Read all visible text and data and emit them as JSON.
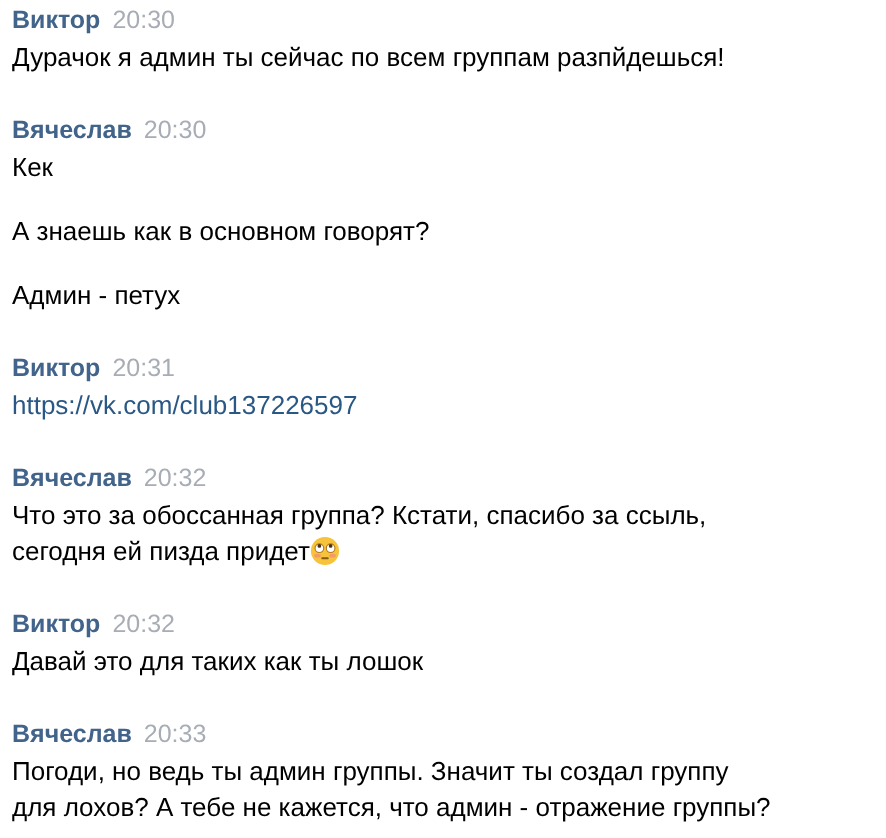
{
  "messages": [
    {
      "author": "Виктор",
      "time": "20:30",
      "paragraphs": [
        {
          "kind": "text",
          "text": "Дурачок я админ ты сейчас по всем группам разпйдешься!"
        }
      ]
    },
    {
      "author": "Вячеслав",
      "time": "20:30",
      "paragraphs": [
        {
          "kind": "text",
          "text": "Кек"
        },
        {
          "kind": "text",
          "text": "А знаешь как в основном говорят?"
        },
        {
          "kind": "text",
          "text": "Админ - петух"
        }
      ]
    },
    {
      "author": "Виктор",
      "time": "20:31",
      "paragraphs": [
        {
          "kind": "link",
          "text": "https://vk.com/club137226597"
        }
      ]
    },
    {
      "author": "Вячеслав",
      "time": "20:32",
      "paragraphs": [
        {
          "kind": "text",
          "text": "Что это за обоссанная группа? Кстати, спасибо за ссыль, сегодня ей пизда придет",
          "emoji": true
        }
      ]
    },
    {
      "author": "Виктор",
      "time": "20:32",
      "paragraphs": [
        {
          "kind": "text",
          "text": "Давай это для таких как ты лошок"
        }
      ]
    },
    {
      "author": "Вячеслав",
      "time": "20:33",
      "paragraphs": [
        {
          "kind": "text",
          "text": "Погоди, но ведь ты админ группы. Значит ты создал группу для лохов? А тебе не кажется, что админ - отражение группы?"
        }
      ]
    }
  ]
}
